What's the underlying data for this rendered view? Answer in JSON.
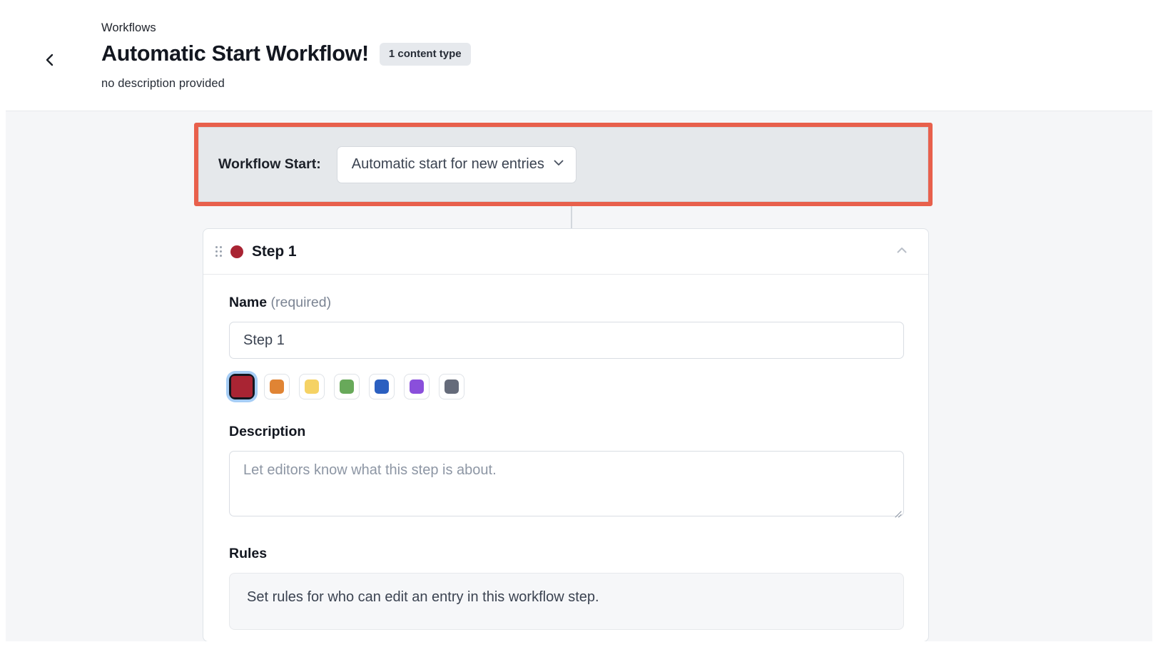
{
  "header": {
    "back_icon": "chevron-left-icon",
    "breadcrumb": "Workflows",
    "title": "Automatic Start Workflow!",
    "badge": "1 content type",
    "subtitle": "no description provided"
  },
  "workflow_start": {
    "label": "Workflow Start:",
    "selected_option": "Automatic start for new entries",
    "chevron_icon": "chevron-down-icon",
    "highlight_color": "#e8604c"
  },
  "step": {
    "drag_handle_icon": "drag-handle-icon",
    "dot_color": "#a92433",
    "title": "Step 1",
    "collapse_icon": "chevron-up-icon",
    "name": {
      "label": "Name",
      "required_text": "(required)",
      "value": "Step 1",
      "placeholder": "Step 1"
    },
    "colors": [
      {
        "name": "red",
        "hex": "#a92433",
        "selected": true
      },
      {
        "name": "orange",
        "hex": "#e08434",
        "selected": false
      },
      {
        "name": "yellow",
        "hex": "#f5d264",
        "selected": false
      },
      {
        "name": "green",
        "hex": "#68a95a",
        "selected": false
      },
      {
        "name": "blue",
        "hex": "#2b5fc0",
        "selected": false
      },
      {
        "name": "purple",
        "hex": "#8a4fdb",
        "selected": false
      },
      {
        "name": "gray",
        "hex": "#656b7a",
        "selected": false
      }
    ],
    "description": {
      "label": "Description",
      "value": "",
      "placeholder": "Let editors know what this step is about."
    },
    "rules": {
      "label": "Rules",
      "panel_text": "Set rules for who can edit an entry in this workflow step."
    }
  }
}
